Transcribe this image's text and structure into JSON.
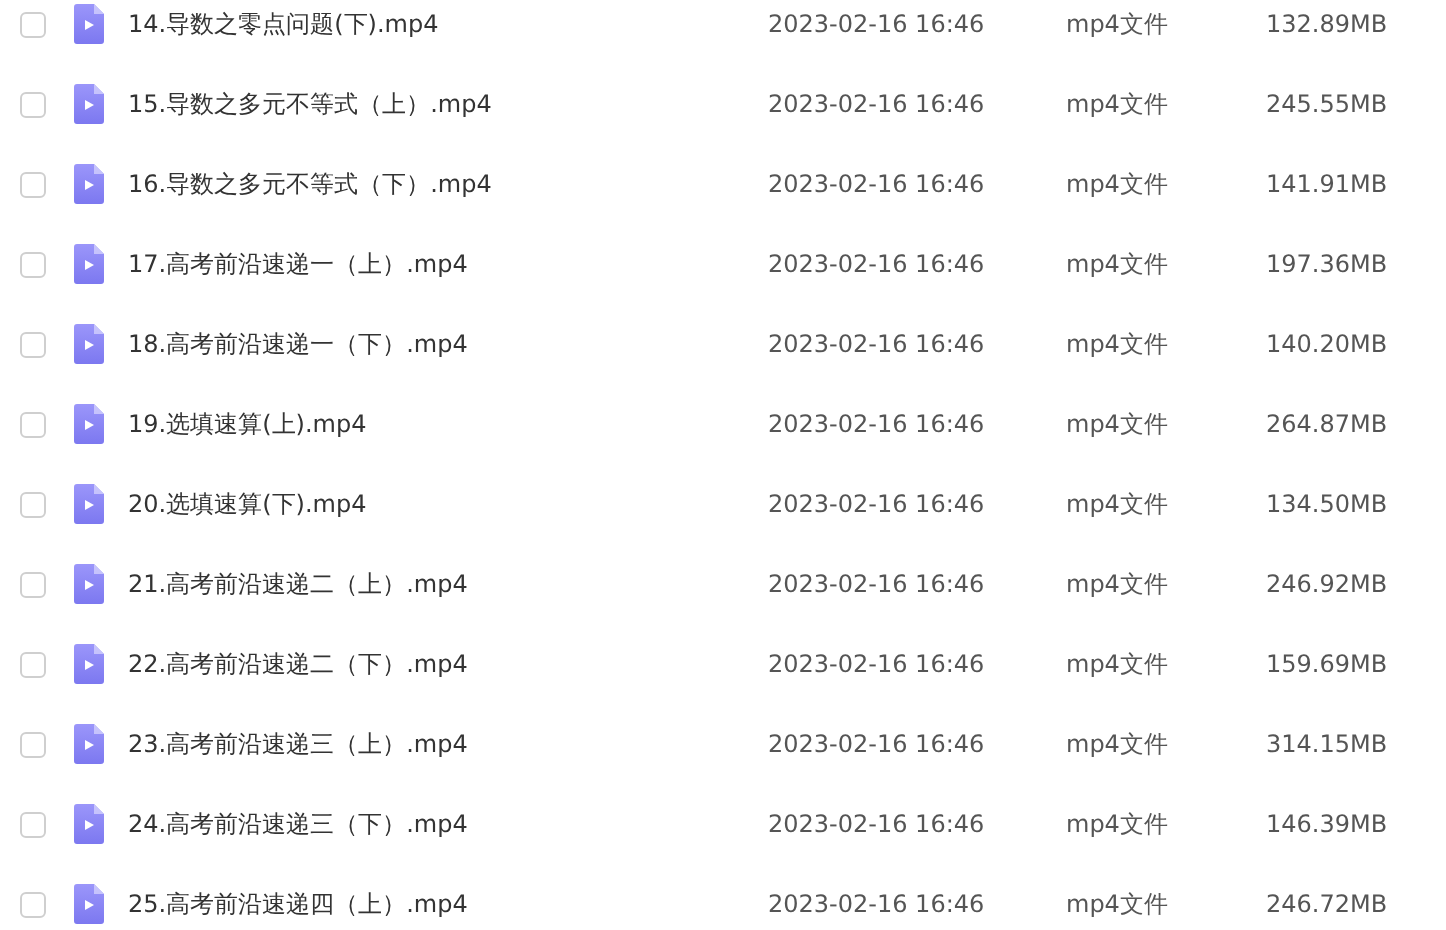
{
  "files": [
    {
      "name": "14.导数之零点问题(下).mp4",
      "date": "2023-02-16 16:46",
      "type": "mp4文件",
      "size": "132.89MB",
      "checked": false
    },
    {
      "name": "15.导数之多元不等式（上）.mp4",
      "date": "2023-02-16 16:46",
      "type": "mp4文件",
      "size": "245.55MB",
      "checked": false
    },
    {
      "name": "16.导数之多元不等式（下）.mp4",
      "date": "2023-02-16 16:46",
      "type": "mp4文件",
      "size": "141.91MB",
      "checked": false
    },
    {
      "name": "17.高考前沿速递一（上）.mp4",
      "date": "2023-02-16 16:46",
      "type": "mp4文件",
      "size": "197.36MB",
      "checked": false
    },
    {
      "name": "18.高考前沿速递一（下）.mp4",
      "date": "2023-02-16 16:46",
      "type": "mp4文件",
      "size": "140.20MB",
      "checked": false
    },
    {
      "name": "19.选填速算(上).mp4",
      "date": "2023-02-16 16:46",
      "type": "mp4文件",
      "size": "264.87MB",
      "checked": false
    },
    {
      "name": "20.选填速算(下).mp4",
      "date": "2023-02-16 16:46",
      "type": "mp4文件",
      "size": "134.50MB",
      "checked": false
    },
    {
      "name": "21.高考前沿速递二（上）.mp4",
      "date": "2023-02-16 16:46",
      "type": "mp4文件",
      "size": "246.92MB",
      "checked": false
    },
    {
      "name": "22.高考前沿速递二（下）.mp4",
      "date": "2023-02-16 16:46",
      "type": "mp4文件",
      "size": "159.69MB",
      "checked": false
    },
    {
      "name": "23.高考前沿速递三（上）.mp4",
      "date": "2023-02-16 16:46",
      "type": "mp4文件",
      "size": "314.15MB",
      "checked": false
    },
    {
      "name": "24.高考前沿速递三（下）.mp4",
      "date": "2023-02-16 16:46",
      "type": "mp4文件",
      "size": "146.39MB",
      "checked": false
    },
    {
      "name": "25.高考前沿速递四（上）.mp4",
      "date": "2023-02-16 16:46",
      "type": "mp4文件",
      "size": "246.72MB",
      "checked": false
    }
  ]
}
